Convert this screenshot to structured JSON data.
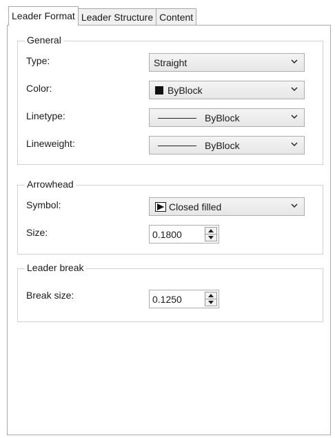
{
  "tabs": [
    {
      "label": "Leader Format",
      "active": true
    },
    {
      "label": "Leader Structure",
      "active": false
    },
    {
      "label": "Content",
      "active": false
    }
  ],
  "general": {
    "legend": "General",
    "type": {
      "label": "Type:",
      "value": "Straight"
    },
    "color": {
      "label": "Color:",
      "value": "ByBlock",
      "swatch": "#111111"
    },
    "linetype": {
      "label": "Linetype:",
      "value": "ByBlock"
    },
    "lineweight": {
      "label": "Lineweight:",
      "value": "ByBlock"
    }
  },
  "arrowhead": {
    "legend": "Arrowhead",
    "symbol": {
      "label": "Symbol:",
      "value": "Closed filled",
      "icon": "closed-filled-arrow-icon"
    },
    "size": {
      "label": "Size:",
      "value": "0.1800"
    }
  },
  "leader_break": {
    "legend": "Leader break",
    "break_size": {
      "label": "Break size:",
      "value": "0.1250"
    }
  }
}
